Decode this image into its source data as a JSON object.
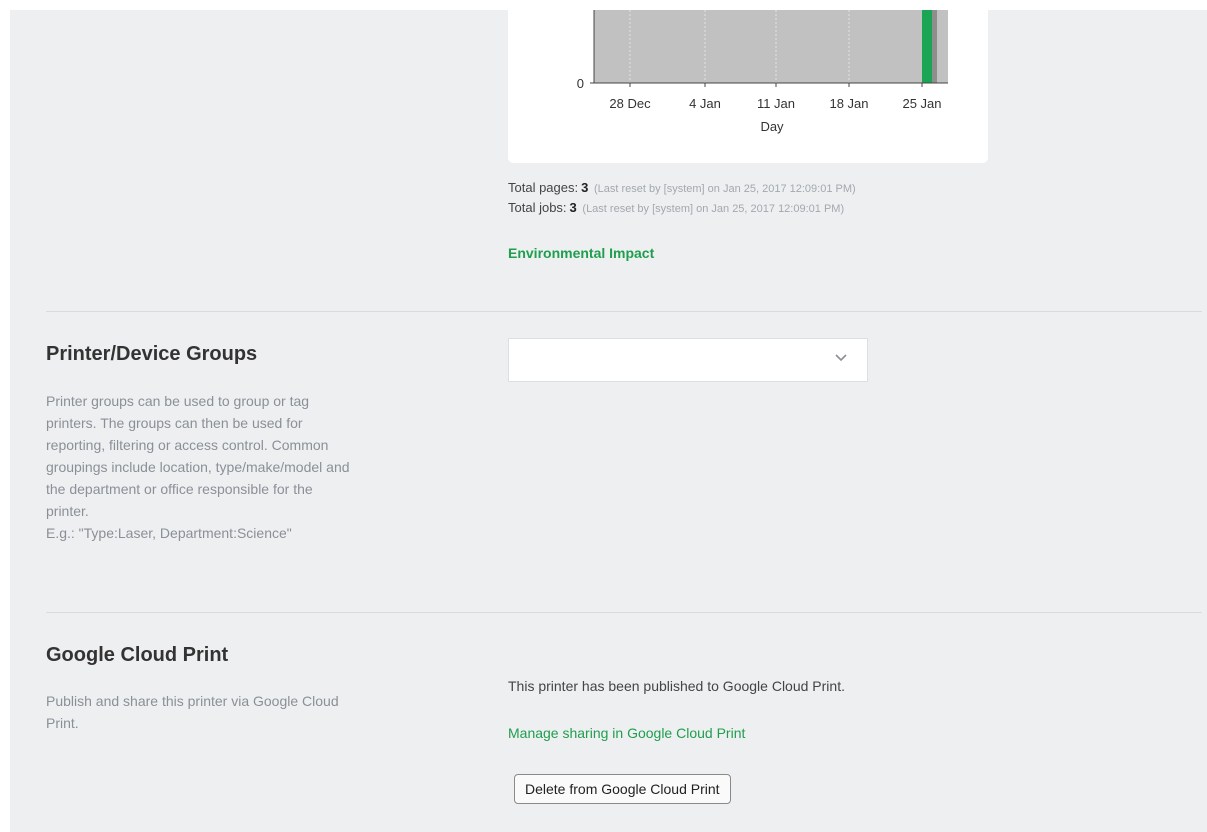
{
  "chart": {
    "y_tick": "0",
    "x_ticks": [
      "28 Dec",
      "4 Jan",
      "11 Jan",
      "18 Jan",
      "25 Jan"
    ],
    "xlabel": "Day",
    "bar_color": "#1aa555"
  },
  "chart_data": {
    "type": "bar",
    "xlabel": "Day",
    "ylabel": "",
    "x_tick_labels": [
      "28 Dec",
      "4 Jan",
      "11 Jan",
      "18 Jan",
      "25 Jan"
    ],
    "grid": true,
    "series": [
      {
        "x": "25 Jan",
        "value": 3
      }
    ]
  },
  "stats": {
    "pages_label": "Total pages:",
    "pages_value": "3",
    "pages_note": "(Last reset by [system] on Jan 25, 2017 12:09:01 PM)",
    "jobs_label": "Total jobs:",
    "jobs_value": "3",
    "jobs_note": "(Last reset by [system] on Jan 25, 2017 12:09:01 PM)"
  },
  "environmental_link": "Environmental Impact",
  "groups": {
    "title": "Printer/Device Groups",
    "desc_lines": [
      "Printer groups can be used to group or tag",
      "printers. The groups can then be used for",
      "reporting, filtering or access control. Common",
      "groupings include location, type/make/model and",
      "the department or office responsible for the",
      "printer.",
      "E.g.: \"Type:Laser, Department:Science\""
    ],
    "select_value": ""
  },
  "gcp": {
    "title": "Google Cloud Print",
    "desc_lines": [
      "Publish and share this printer via Google Cloud",
      "Print."
    ],
    "status_text": "This printer has been published to Google Cloud Print.",
    "manage_link": "Manage sharing in Google Cloud Print",
    "delete_button": "Delete from Google Cloud Print"
  },
  "colors": {
    "accent": "#1f9e4e",
    "page_bg": "#eeeff1"
  }
}
